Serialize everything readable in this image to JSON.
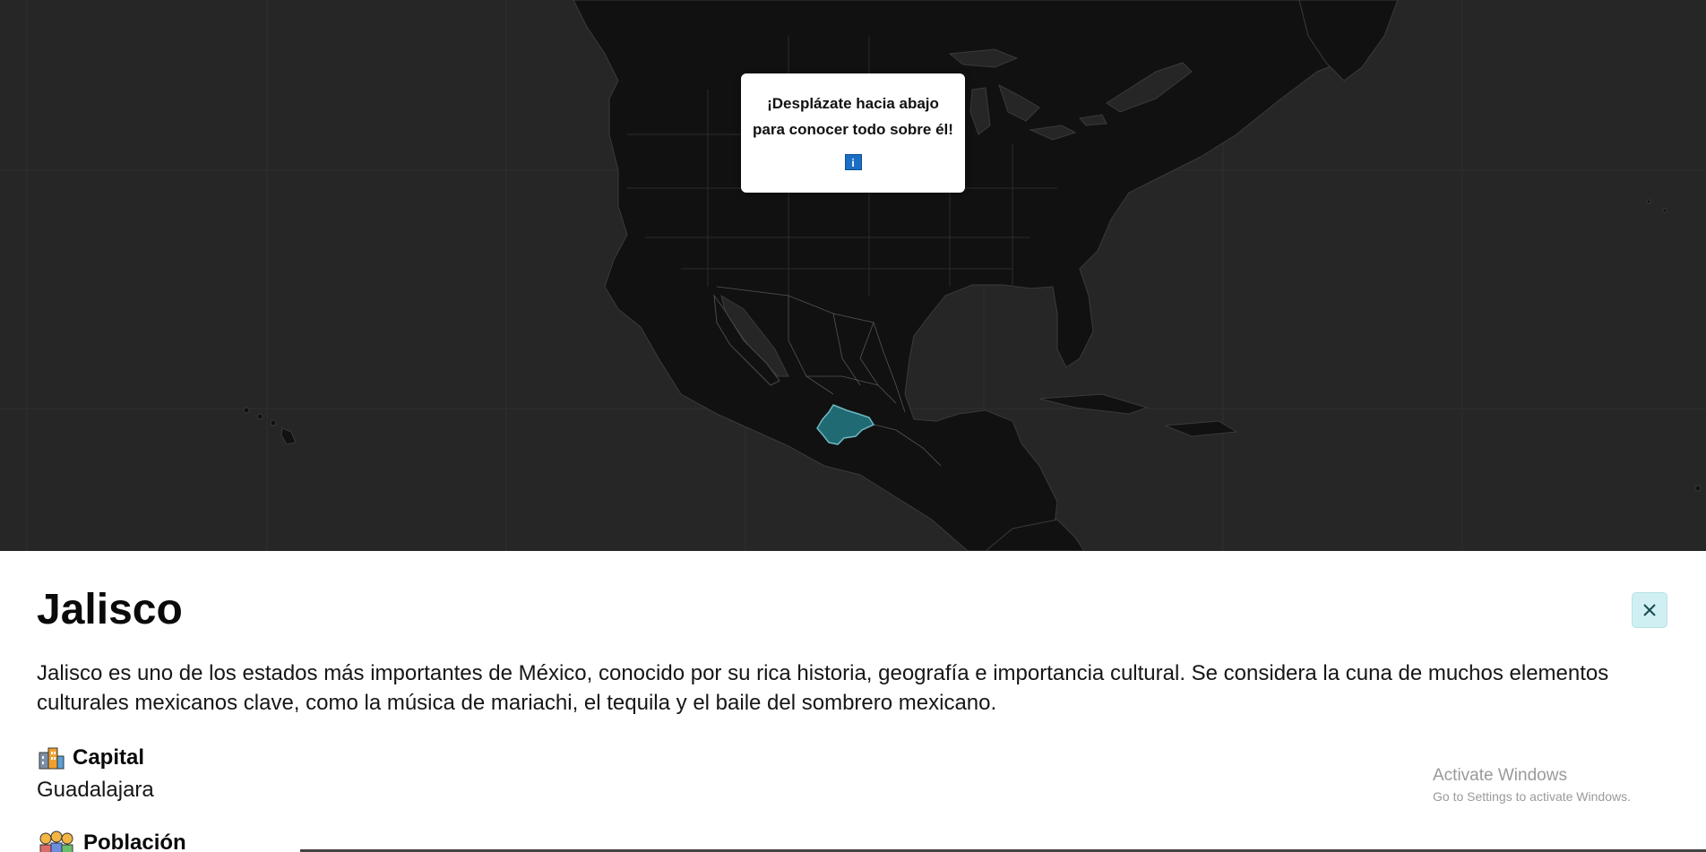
{
  "map": {
    "background": "#262626",
    "land_color": "#111111",
    "border_color": "#3a3a3a",
    "highlight_color": "#1f6a73",
    "highlighted_region": "Jalisco"
  },
  "popup": {
    "line1": "¡Desplázate hacia abajo",
    "line2": "para conocer todo sobre él!",
    "info_icon": "i"
  },
  "panel": {
    "title": "Jalisco",
    "close_icon": "close-icon",
    "description": "Jalisco es uno de los estados más importantes de México, conocido por su rica historia, geografía e importancia cultural. Se considera la cuna de muchos elementos culturales mexicanos clave, como la música de mariachi, el tequila y el baile del sombrero mexicano.",
    "facts": [
      {
        "icon": "city-icon",
        "label": "Capital",
        "value": "Guadalajara"
      },
      {
        "icon": "people-icon",
        "label": "Población",
        "value": ""
      }
    ]
  },
  "watermark": {
    "title": "Activate Windows",
    "subtitle": "Go to Settings to activate Windows."
  }
}
